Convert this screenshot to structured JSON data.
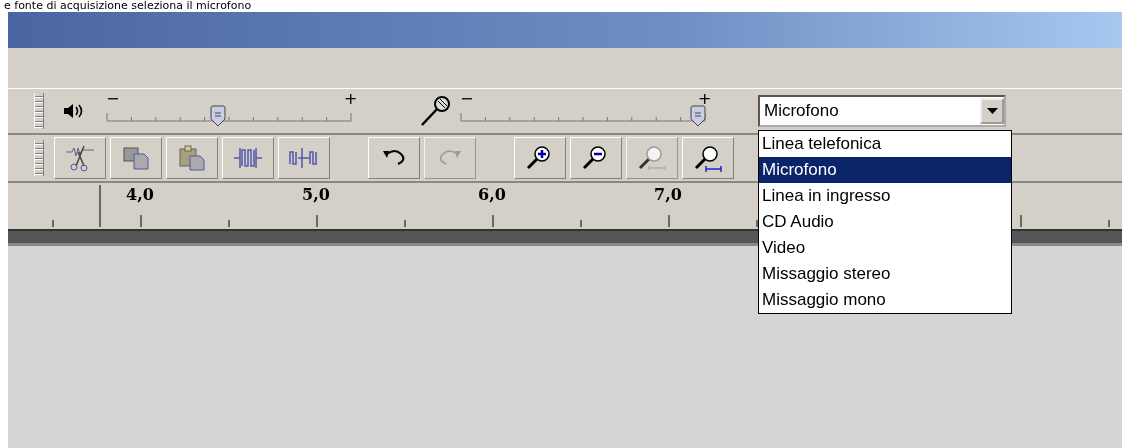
{
  "caption": "e fonte di acquisizione seleziona il microfono",
  "meter_toolbar": {
    "playback": {
      "min": "−",
      "max": "+",
      "level": 0.45
    },
    "recording": {
      "min": "−",
      "max": "+",
      "level": 1.0
    }
  },
  "input_source": {
    "value": "Microfono",
    "options": [
      {
        "label": "Linea telefonica",
        "selected": false
      },
      {
        "label": "Microfono",
        "selected": true
      },
      {
        "label": "Linea in ingresso",
        "selected": false
      },
      {
        "label": "CD Audio",
        "selected": false
      },
      {
        "label": "Video",
        "selected": false
      },
      {
        "label": "Missaggio stereo",
        "selected": false
      },
      {
        "label": "Missaggio mono",
        "selected": false
      }
    ]
  },
  "edit_toolbar": {
    "groups": [
      [
        {
          "kind": "cut",
          "disabled": false
        },
        {
          "kind": "copy",
          "disabled": false
        },
        {
          "kind": "paste",
          "disabled": false
        },
        {
          "kind": "trim",
          "disabled": false
        },
        {
          "kind": "silence",
          "disabled": false
        }
      ],
      [
        {
          "kind": "undo",
          "disabled": false
        },
        {
          "kind": "redo",
          "disabled": true
        }
      ],
      [
        {
          "kind": "zoom-in",
          "disabled": false
        },
        {
          "kind": "zoom-out",
          "disabled": false
        },
        {
          "kind": "zoom-fit",
          "disabled": true
        },
        {
          "kind": "zoom-selection",
          "disabled": false
        }
      ]
    ]
  },
  "ruler": {
    "labels": [
      "4,0",
      "5,0",
      "6,0",
      "7,0"
    ]
  }
}
